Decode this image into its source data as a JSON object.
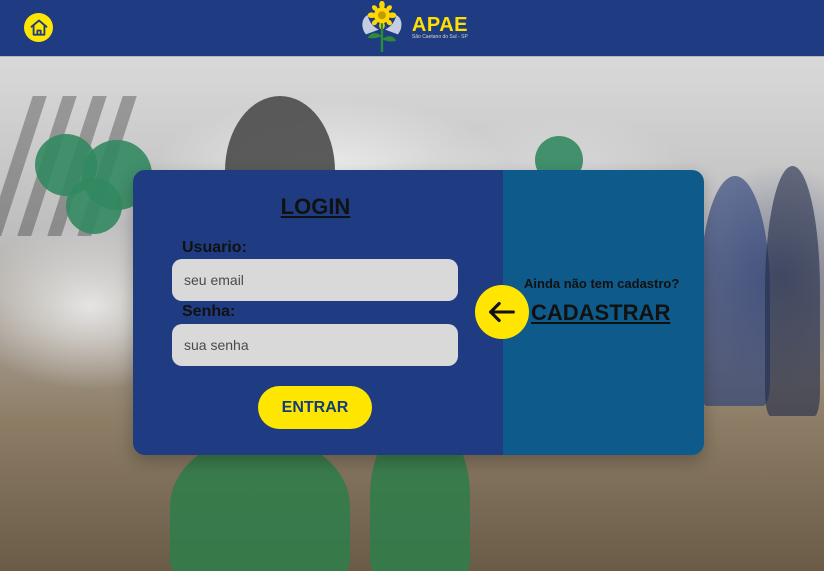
{
  "header": {
    "brand_name": "APAE",
    "brand_sub": "São Caetano do Sul - SP",
    "home_icon": "home-icon",
    "colors": {
      "bar": "#1f3c82",
      "accent": "#ffe600"
    }
  },
  "login": {
    "title": "LOGIN",
    "username_label": "Usuario:",
    "username_placeholder": "seu email",
    "password_label": "Senha:",
    "password_placeholder": "sua senha",
    "submit_label": "ENTRAR"
  },
  "signup": {
    "question": "Ainda não tem cadastro?",
    "link_label": "CADASTRAR",
    "arrow_icon": "arrow-left-icon",
    "panel_color": "#0e5a8a"
  }
}
